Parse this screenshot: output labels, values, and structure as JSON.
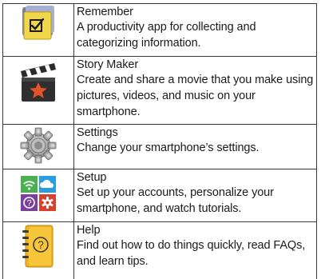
{
  "apps": [
    {
      "icon": "remember-app-icon",
      "name": "Remember",
      "description": "A productivity app for collecting and categorizing information."
    },
    {
      "icon": "story-maker-app-icon",
      "name": "Story Maker",
      "description": "Create and share a movie that you make using pictures, videos, and music on your smartphone."
    },
    {
      "icon": "settings-gear-icon",
      "name": "Settings",
      "description": "Change your smartphone’s settings."
    },
    {
      "icon": "setup-app-icon",
      "name": "Setup",
      "description": "Set up your accounts, personalize your smartphone, and watch tutorials."
    },
    {
      "icon": "help-book-icon",
      "name": "Help",
      "description": "Find out how to do things quickly, read FAQs, and learn tips."
    }
  ],
  "colors": {
    "border": "#3a3a3a",
    "text": "#1a1a1a",
    "remember_note": "#f1d54a",
    "story_maker_star": "#e2552a",
    "setup_green": "#4caf50",
    "setup_blue": "#2a9de0",
    "setup_purple": "#7b3fa0",
    "setup_red": "#d9412f",
    "help_book": "#f0b420"
  }
}
